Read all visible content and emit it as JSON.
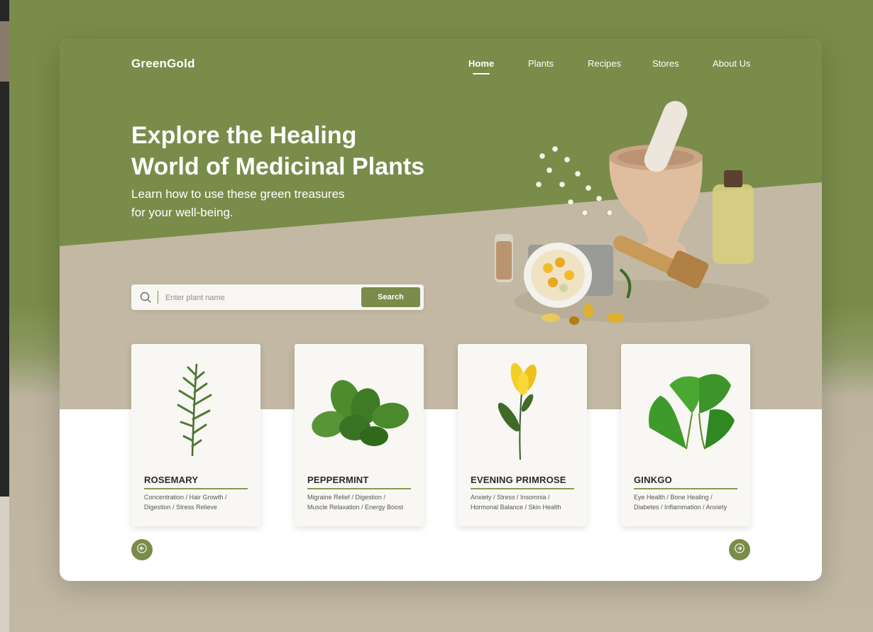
{
  "brand": "GreenGold",
  "nav": [
    {
      "label": "Home",
      "active": true
    },
    {
      "label": "Plants",
      "active": false
    },
    {
      "label": "Recipes",
      "active": false
    },
    {
      "label": "Stores",
      "active": false
    },
    {
      "label": "About Us",
      "active": false
    }
  ],
  "hero": {
    "title_line1": "Explore the Healing",
    "title_line2": "World of Medicinal Plants",
    "subtitle_line1": "Learn how to use these green treasures",
    "subtitle_line2": "for your well-being."
  },
  "search": {
    "placeholder": "Enter plant name",
    "value": "",
    "button_label": "Search",
    "icon": "search-icon"
  },
  "plants": [
    {
      "name": "ROSEMARY",
      "benefits_line1": "Concentration / Hair Growth /",
      "benefits_line2": "Digestion / Stress Relieve"
    },
    {
      "name": "PEPPERMINT",
      "benefits_line1": "Migraine Relief / Digestion /",
      "benefits_line2": "Muscle Relaxation / Energy Boost"
    },
    {
      "name": "EVENING PRIMROSE",
      "benefits_line1": "Anxiety / Stress / Insomnia /",
      "benefits_line2": "Hormonal Balance / Skin Health"
    },
    {
      "name": "GINKGO",
      "benefits_line1": "Eye Health / Bone Healing /",
      "benefits_line2": "Diabetes / Inflammation / Anxiety"
    }
  ],
  "carousel": {
    "prev_icon": "arrow-left-icon",
    "next_icon": "arrow-right-icon"
  },
  "colors": {
    "brand_green": "#7a8c49",
    "beige": "#c2b8a3",
    "card_bg": "#f8f7f3",
    "accent_rule": "#8b9a52"
  }
}
